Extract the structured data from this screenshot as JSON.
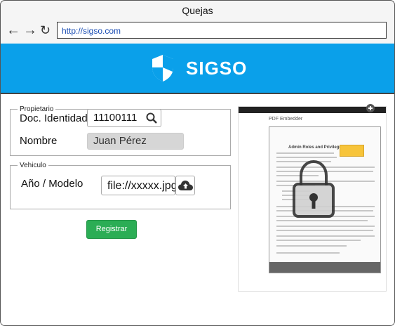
{
  "window": {
    "title": "Quejas"
  },
  "browser": {
    "url": "http://sigso.com"
  },
  "header": {
    "brand": "SIGSO",
    "brand_color": "#0aa0ea"
  },
  "owner": {
    "legend": "Propietario",
    "doc_label": "Doc. Identidad",
    "doc_value": "11100111",
    "name_label": "Nombre",
    "name_value": "Juan Pérez"
  },
  "vehicle": {
    "legend": "Vehiculo",
    "model_label": "Año / Modelo",
    "file_value": "file://xxxxx.jpg"
  },
  "actions": {
    "submit_label": "Registrar",
    "submit_color": "#2bad55"
  },
  "preview": {
    "doc_title": "Admin Roles and Privileges",
    "page_heading": "PDF Embedder"
  }
}
